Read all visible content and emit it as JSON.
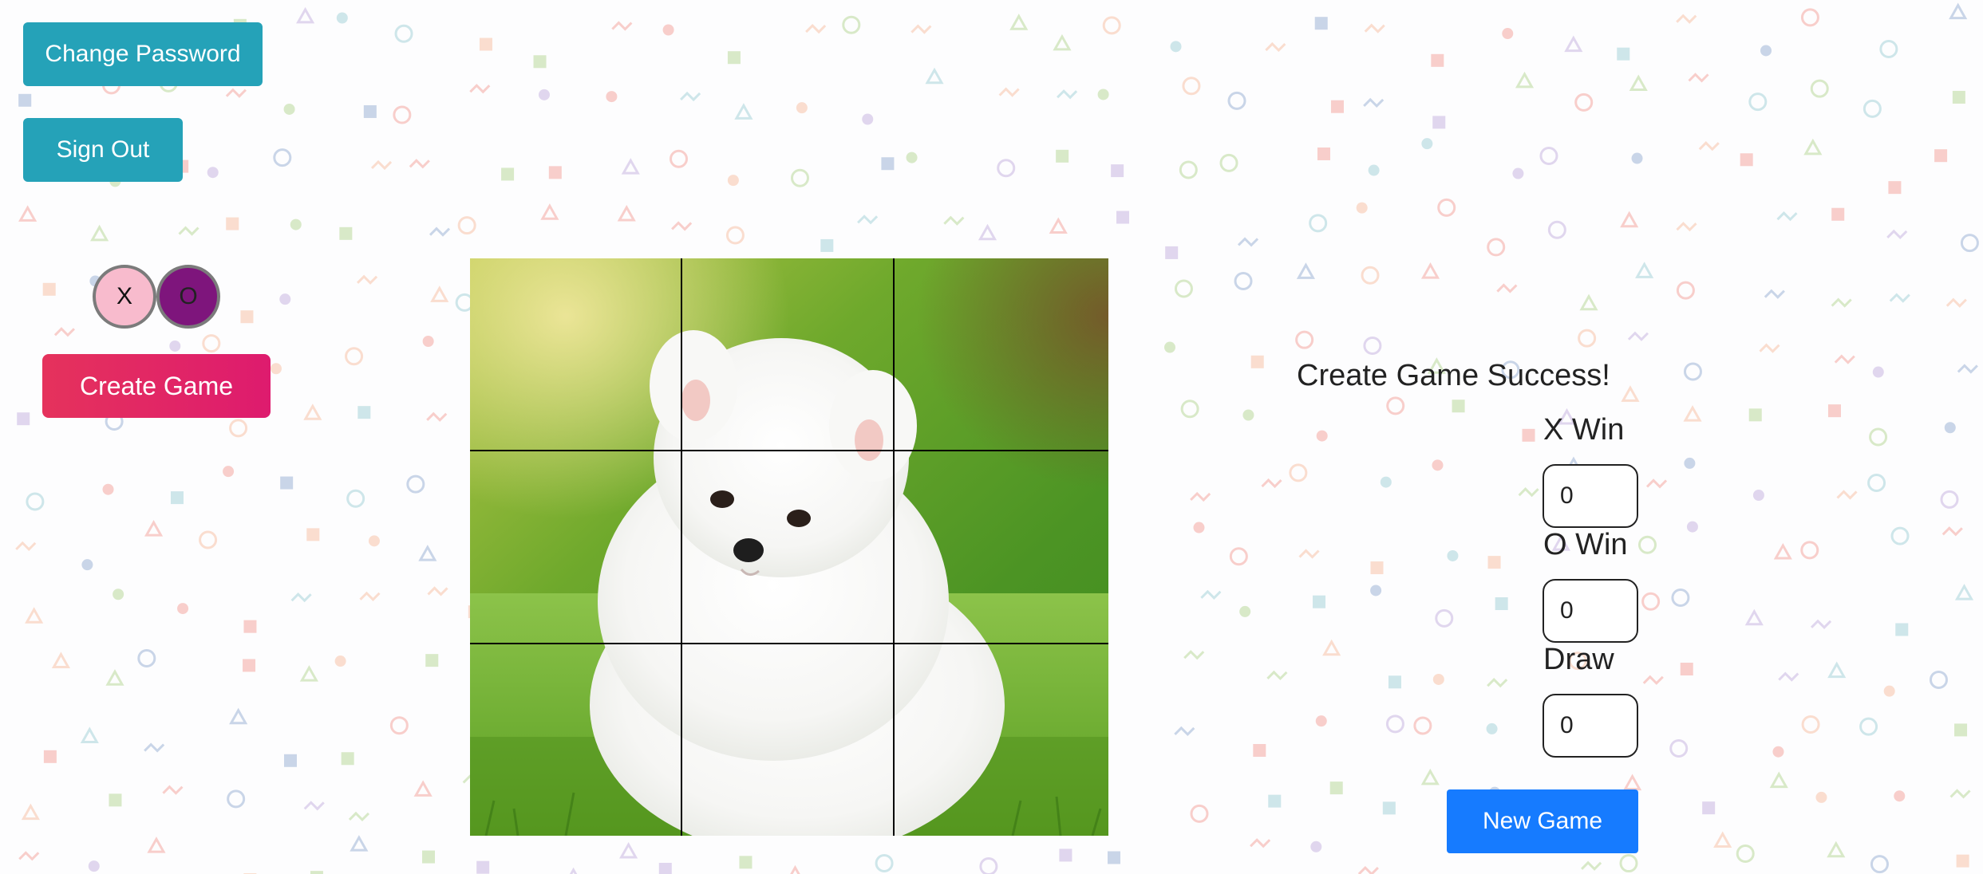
{
  "nav": {
    "change_password_label": "Change Password",
    "sign_out_label": "Sign Out"
  },
  "tokens": {
    "x_label": "X",
    "o_label": "O",
    "x_color": "#f8bbcd",
    "o_color": "#7e157c"
  },
  "create_game_label": "Create Game",
  "board": {
    "cells": [
      "",
      "",
      "",
      "",
      "",
      "",
      "",
      "",
      ""
    ],
    "background_image": "puppy-photo"
  },
  "panel": {
    "status_message": "Create Game Success!",
    "x_win_label": "X Win",
    "x_win_value": "0",
    "o_win_label": "O Win",
    "o_win_value": "0",
    "draw_label": "Draw",
    "draw_value": "0",
    "new_game_label": "New Game"
  },
  "colors": {
    "teal_button": "#25a2b8",
    "pink_button": "#e5325c",
    "blue_button": "#167bff"
  }
}
